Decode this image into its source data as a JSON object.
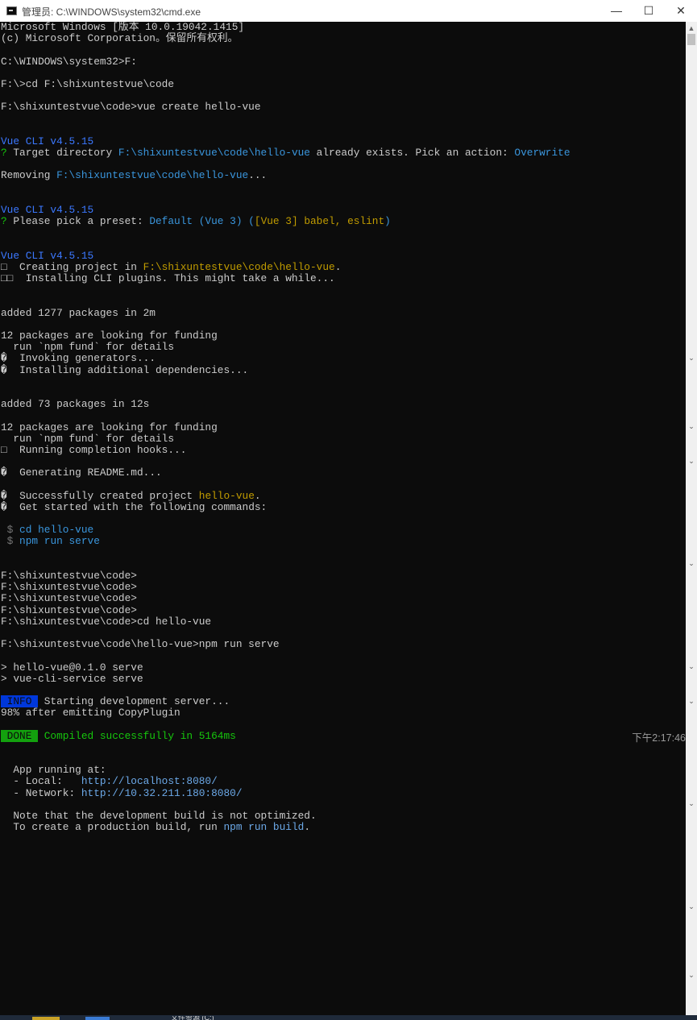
{
  "window": {
    "title": "管理员: C:\\WINDOWS\\system32\\cmd.exe",
    "minimize": "—",
    "maximize": "☐",
    "close": "✕"
  },
  "console": {
    "lines": [
      [
        {
          "t": "Microsoft Windows [版本 10.0.19042.1415]"
        }
      ],
      [
        {
          "t": "(c) Microsoft Corporation。保留所有权利。"
        }
      ],
      [],
      [
        {
          "t": "C:\\WINDOWS\\system32>F:"
        }
      ],
      [],
      [
        {
          "t": "F:\\>cd F:\\shixuntestvue\\code"
        }
      ],
      [],
      [
        {
          "t": "F:\\shixuntestvue\\code>vue create hello-vue"
        }
      ],
      [],
      [],
      [
        {
          "t": "Vue CLI v4.5.15",
          "c": "blue"
        }
      ],
      [
        {
          "t": "?",
          "c": "green"
        },
        {
          "t": " Target directory "
        },
        {
          "t": "F:\\shixuntestvue\\code\\hello-vue",
          "c": "cyan"
        },
        {
          "t": " already exists. Pick an action: "
        },
        {
          "t": "Overwrite",
          "c": "cyan"
        }
      ],
      [],
      [
        {
          "t": "Removing "
        },
        {
          "t": "F:\\shixuntestvue\\code\\hello-vue",
          "c": "cyan"
        },
        {
          "t": "..."
        }
      ],
      [],
      [],
      [
        {
          "t": "Vue CLI v4.5.15",
          "c": "blue"
        }
      ],
      [
        {
          "t": "?",
          "c": "green"
        },
        {
          "t": " Please pick a preset: "
        },
        {
          "t": "Default (Vue 3) (",
          "c": "cyan"
        },
        {
          "t": "[Vue 3] babel, eslint",
          "c": "yellow"
        },
        {
          "t": ")",
          "c": "cyan"
        }
      ],
      [],
      [],
      [
        {
          "t": "Vue CLI v4.5.15",
          "c": "blue"
        }
      ],
      [
        {
          "t": "□  Creating project in "
        },
        {
          "t": "F:\\shixuntestvue\\code\\hello-vue",
          "c": "yellow"
        },
        {
          "t": "."
        }
      ],
      [
        {
          "t": "□□  Installing CLI plugins. This might take a while..."
        }
      ],
      [],
      [],
      [
        {
          "t": "added 1277 packages in 2m"
        }
      ],
      [],
      [
        {
          "t": "12 packages are looking for funding"
        }
      ],
      [
        {
          "t": "  run `npm fund` for details"
        }
      ],
      [
        {
          "t": "�  Invoking generators..."
        }
      ],
      [
        {
          "t": "�  Installing additional dependencies..."
        }
      ],
      [],
      [],
      [
        {
          "t": "added 73 packages in 12s"
        }
      ],
      [],
      [
        {
          "t": "12 packages are looking for funding"
        }
      ],
      [
        {
          "t": "  run `npm fund` for details"
        }
      ],
      [
        {
          "t": "□  Running completion hooks..."
        }
      ],
      [],
      [
        {
          "t": "�  Generating README.md..."
        }
      ],
      [],
      [
        {
          "t": "�  Successfully created project "
        },
        {
          "t": "hello-vue",
          "c": "yellow"
        },
        {
          "t": "."
        }
      ],
      [
        {
          "t": "�  Get started with the following commands:"
        }
      ],
      [],
      [
        {
          "t": " $ ",
          "c": "gray"
        },
        {
          "t": "cd hello-vue",
          "c": "cyan"
        }
      ],
      [
        {
          "t": " $ ",
          "c": "gray"
        },
        {
          "t": "npm run serve",
          "c": "cyan"
        }
      ],
      [],
      [],
      [
        {
          "t": "F:\\shixuntestvue\\code>"
        }
      ],
      [
        {
          "t": "F:\\shixuntestvue\\code>"
        }
      ],
      [
        {
          "t": "F:\\shixuntestvue\\code>"
        }
      ],
      [
        {
          "t": "F:\\shixuntestvue\\code>"
        }
      ],
      [
        {
          "t": "F:\\shixuntestvue\\code>cd hello-vue"
        }
      ],
      [],
      [
        {
          "t": "F:\\shixuntestvue\\code\\hello-vue>npm run serve"
        }
      ],
      [],
      [
        {
          "t": "> hello-vue@0.1.0 serve"
        }
      ],
      [
        {
          "t": "> vue-cli-service serve"
        }
      ],
      [],
      [
        {
          "t": " INFO ",
          "c": "badge-info"
        },
        {
          "t": " Starting development server..."
        }
      ],
      [
        {
          "t": "98% after emitting CopyPlugin"
        }
      ],
      [],
      [
        {
          "t": " DONE ",
          "c": "badge-done"
        },
        {
          "t": " Compiled successfully in 5164ms",
          "c": "green"
        }
      ],
      [],
      [],
      [
        {
          "t": "  App running at:"
        }
      ],
      [
        {
          "t": "  - Local:   "
        },
        {
          "t": "http://localhost:8080/",
          "c": "lblue"
        }
      ],
      [
        {
          "t": "  - Network: "
        },
        {
          "t": "http://10.32.211.180:8080/",
          "c": "lblue"
        }
      ],
      [],
      [
        {
          "t": "  Note that the development build is not optimized."
        }
      ],
      [
        {
          "t": "  To create a production build, run "
        },
        {
          "t": "npm run build",
          "c": "lblue"
        },
        {
          "t": "."
        }
      ]
    ],
    "timestamp": "下午2:17:46"
  },
  "scrollbar": {
    "up_arrow": "▲",
    "down_arrow": "⌄"
  },
  "taskbar": {
    "item_label": "文件资源 (C:)"
  }
}
